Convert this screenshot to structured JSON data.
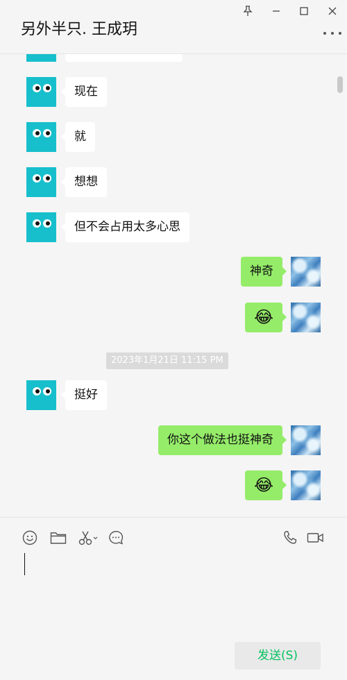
{
  "window": {
    "title": "另外半只. 王成玥"
  },
  "icons": {
    "pin": "pin-icon",
    "minimize": "minimize-icon",
    "maximize": "maximize-icon",
    "close": "close-icon",
    "more": "more-icon",
    "emoji": "emoji-icon",
    "folder": "folder-icon",
    "scissors": "scissors-icon",
    "chat": "chat-bubble-icon",
    "phone": "phone-icon",
    "video": "video-camera-icon"
  },
  "messages": [
    {
      "side": "left",
      "text": "现在"
    },
    {
      "side": "left",
      "text": "就"
    },
    {
      "side": "left",
      "text": "想想"
    },
    {
      "side": "left",
      "text": "但不会占用太多心思"
    },
    {
      "side": "right",
      "text": "神奇"
    },
    {
      "side": "right",
      "text": "😂"
    },
    {
      "side": "left",
      "text": "挺好"
    },
    {
      "side": "right",
      "text": "你这个做法也挺神奇"
    },
    {
      "side": "right",
      "text": "😂"
    }
  ],
  "timestamp": "2023年1月21日 11:15 PM",
  "compose": {
    "send_label": "发送(S)"
  },
  "colors": {
    "accent": "#07c160",
    "bubble_self": "#95ec69",
    "bubble_other": "#ffffff",
    "avatar_other": "#17bfcc"
  }
}
